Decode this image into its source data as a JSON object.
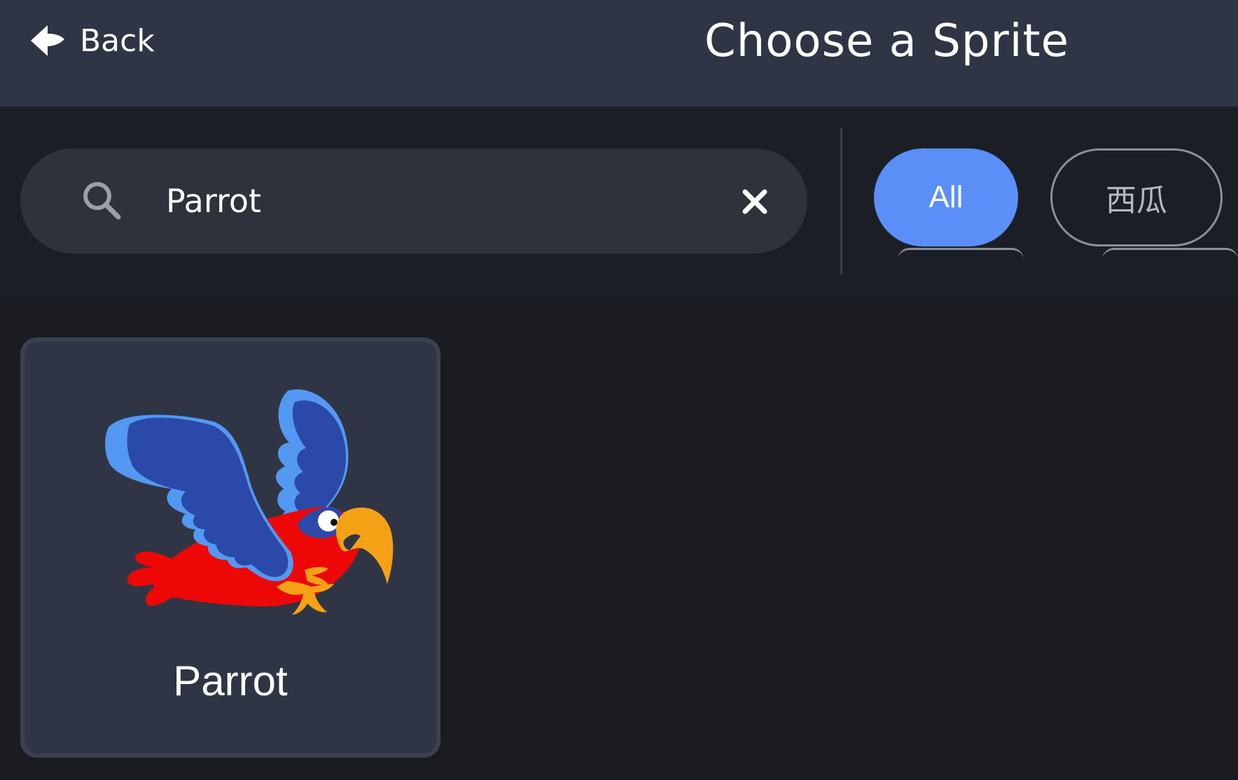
{
  "header": {
    "back_label": "Back",
    "title": "Choose a Sprite",
    "background": "#2f3544"
  },
  "search": {
    "value": "Parrot",
    "placeholder": "Search",
    "icon": "search-icon",
    "clear_icon": "close-icon"
  },
  "filters": {
    "items": [
      {
        "label": "All",
        "selected": true
      },
      {
        "label": "西瓜",
        "selected": false
      }
    ],
    "accent": "#5a8ff7"
  },
  "results": {
    "items": [
      {
        "name": "Parrot",
        "image": "parrot-illustration"
      }
    ]
  }
}
